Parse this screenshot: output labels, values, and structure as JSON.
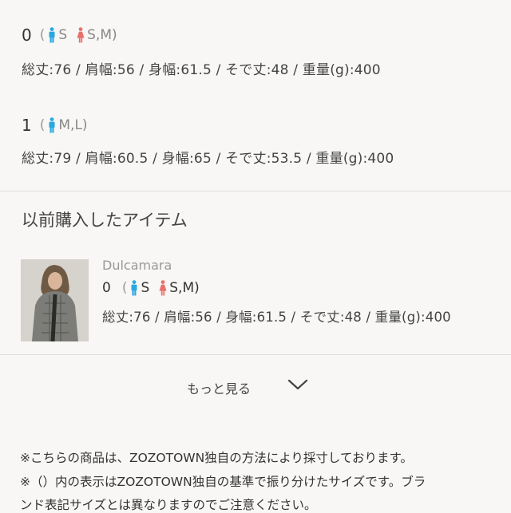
{
  "sizes": [
    {
      "size": "0",
      "paren_open": "(",
      "men": "S",
      "women": "S,M)",
      "measurements": "総丈:76 / 肩幅:56 / 身幅:61.5 / そで丈:48 / 重量(g):400"
    },
    {
      "size": "1",
      "paren_open": "(",
      "men": "M,L)",
      "measurements": "総丈:79 / 肩幅:60.5 / 身幅:65 / そで丈:53.5 / 重量(g):400"
    }
  ],
  "purchased": {
    "title": "以前購入したアイテム",
    "item": {
      "brand": "Dulcamara",
      "size": "0",
      "paren_open": "(",
      "men": "S",
      "women": "S,M)",
      "measurements": "総丈:76 / 肩幅:56 / 身幅:61.5 / そで丈:48 / 重量(g):400"
    }
  },
  "more_label": "もっと見る",
  "notes": [
    "※こちらの商品は、ZOZOTOWN独自の方法により採寸しております。",
    "※（）内の表示はZOZOTOWN独自の基準で振り分けたサイズです。ブラ",
    "ンド表記サイズとは異なりますのでご注意ください。"
  ],
  "colors": {
    "men": "#29a8e0",
    "women": "#e8706a",
    "background": "#f8f7f5"
  },
  "icons": [
    "male-icon",
    "female-icon",
    "chevron-down-icon"
  ]
}
